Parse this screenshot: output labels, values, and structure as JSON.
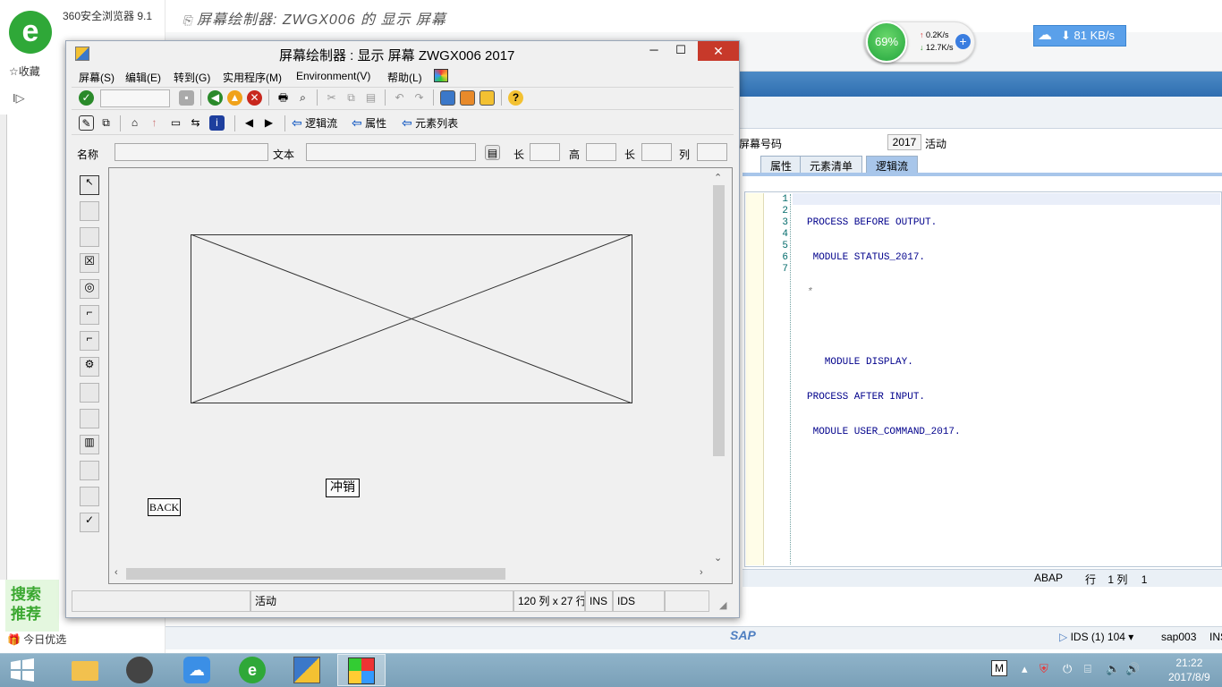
{
  "browser": {
    "name": "360安全浏览器 9.1",
    "favorites": "☆收藏",
    "search_rec": "搜索推荐",
    "today": "今日优选",
    "page_title": "屏幕绘制器: ZWGX006 的 显示 屏幕"
  },
  "speed": {
    "percent": "69%",
    "up": "0.2K/s",
    "down": "12.7K/s",
    "cloud": "81 KB/s"
  },
  "sap_main": {
    "screen_number_label": "屏幕号码",
    "screen_number": "2017",
    "status": "活动",
    "tabs": [
      "属性",
      "元素清单",
      "逻辑流"
    ],
    "active_tab": "逻辑流",
    "line_numbers": [
      "1",
      "2",
      "3",
      "4",
      "5",
      "6",
      "7"
    ],
    "code_lines": [
      "PROCESS BEFORE OUTPUT.",
      " MODULE STATUS_2017.",
      "*",
      "",
      "   MODULE DISPLAY.",
      "PROCESS AFTER INPUT.",
      " MODULE USER_COMMAND_2017."
    ],
    "status_bar": {
      "lang": "ABAP",
      "row_label": "行",
      "row": "1",
      "col_label": "列",
      "col": "1"
    },
    "bottom": {
      "system": "IDS (1) 104",
      "host": "sap003",
      "mode": "INS",
      "sap_logo": "SAP"
    }
  },
  "painter": {
    "title": "屏幕绘制器 : 显示 屏幕 ZWGX006 2017",
    "menus": [
      "屏幕(S)",
      "编辑(E)",
      "转到(G)",
      "实用程序(M)",
      "Environment(V)",
      "帮助(L)"
    ],
    "nav_buttons": [
      "逻辑流",
      "属性",
      "元素列表"
    ],
    "fields": {
      "name_label": "名称",
      "text_label": "文本",
      "len_label": "长",
      "height_label": "高",
      "len2_label": "长",
      "col_label": "列",
      "name_value": "",
      "text_value": ""
    },
    "canvas_buttons": {
      "cancel": "冲销",
      "back": "BACK"
    },
    "status_bar": {
      "status": "活动",
      "size": "120 列 x 27 行",
      "mode": "INS",
      "system": "IDS"
    }
  },
  "taskbar": {
    "time": "21:22",
    "date": "2017/8/9",
    "tray_m": "M"
  }
}
